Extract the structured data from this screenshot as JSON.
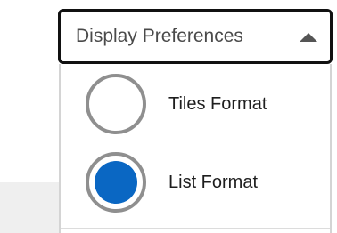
{
  "display_preferences": {
    "toggle_label": "Display Preferences",
    "expanded": true,
    "options": [
      {
        "label": "Tiles Format",
        "selected": false
      },
      {
        "label": "List Format",
        "selected": true
      }
    ]
  },
  "colors": {
    "selected_radio": "#0a67c3",
    "radio_border": "#8f8f8f",
    "toggle_border": "#111111"
  }
}
